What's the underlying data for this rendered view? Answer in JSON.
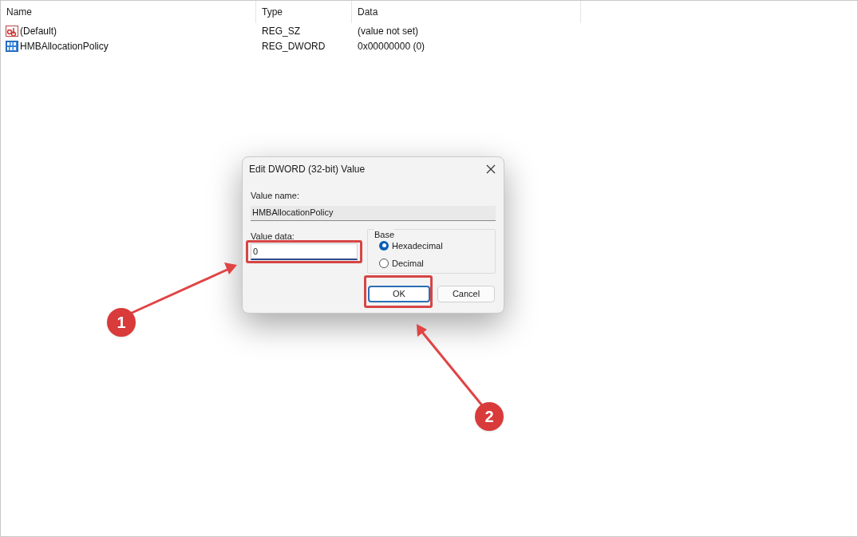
{
  "columns": [
    {
      "label": "Name"
    },
    {
      "label": "Type"
    },
    {
      "label": "Data"
    }
  ],
  "rows": [
    {
      "kind": "string",
      "name": "(Default)",
      "type": "REG_SZ",
      "data": "(value not set)"
    },
    {
      "kind": "binary",
      "name": "HMBAllocationPolicy",
      "type": "REG_DWORD",
      "data": "0x00000000 (0)"
    }
  ],
  "dialog": {
    "title": "Edit DWORD (32-bit) Value",
    "value_name_label": "Value name:",
    "value_name": "HMBAllocationPolicy",
    "value_data_label": "Value data:",
    "value_data": "0",
    "base_label": "Base",
    "base_options": [
      {
        "label": "Hexadecimal",
        "selected": true
      },
      {
        "label": "Decimal",
        "selected": false
      }
    ],
    "buttons": [
      {
        "label": "OK",
        "default": true
      },
      {
        "label": "Cancel",
        "default": false
      }
    ]
  },
  "annotations": [
    {
      "number": "1"
    },
    {
      "number": "2"
    }
  ]
}
